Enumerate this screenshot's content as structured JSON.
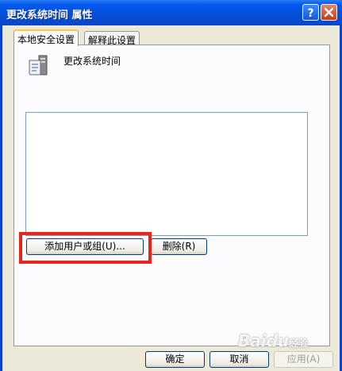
{
  "window": {
    "title": "更改系统时间 属性",
    "help_icon": "help-icon",
    "close_icon": "close-icon"
  },
  "tabs": [
    {
      "label": "本地安全设置",
      "active": true
    },
    {
      "label": "解释此设置",
      "active": false
    }
  ],
  "policy": {
    "icon": "policy-computer-icon",
    "name": "更改系统时间"
  },
  "user_list": [],
  "buttons": {
    "add_user_or_group": "添加用户或组(U)...",
    "remove": "删除(R)",
    "ok": "确定",
    "cancel": "取消",
    "apply": "应用(A)"
  },
  "annotation": {
    "highlight_color": "#e8251c"
  },
  "watermark": {
    "text": "Bai",
    "text2": "du",
    "subtext": "经验"
  }
}
